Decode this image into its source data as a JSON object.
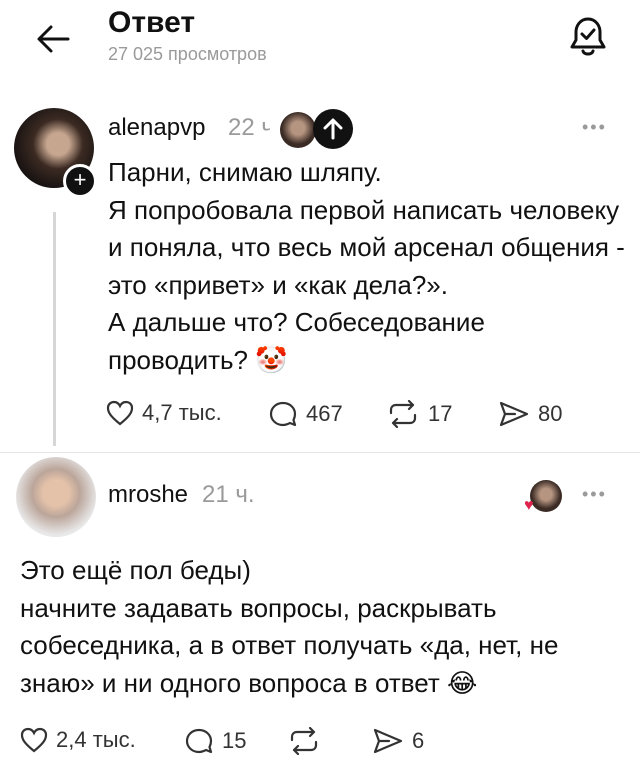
{
  "header": {
    "title": "Ответ",
    "subtitle": "27 025 просмотров",
    "back_icon": "arrow-left-icon",
    "notify_icon": "bell-check-icon"
  },
  "posts": [
    {
      "username": "alenapvp",
      "time": "22 ч.",
      "text": "Парни, снимаю шляпу.\nЯ попробовала первой написать человеку и поняла, что весь мой арсенал общения - это «привет» и «как дела?».\nА дальше что? Собеседование проводить? 🤡",
      "likes": "4,7 тыс.",
      "replies": "467",
      "reposts": "17",
      "shares": "80"
    },
    {
      "username": "mroshe",
      "time": "21 ч.",
      "text": "Это ещё пол беды)\nначните задавать вопросы, раскрывать собеседника, а в ответ получать «да, нет, не знаю» и ни одного вопроса в ответ 😂",
      "likes": "2,4 тыс.",
      "replies": "15",
      "reposts": "",
      "shares": "6"
    }
  ],
  "more_label": "•••",
  "plus_label": "+",
  "colors": {
    "accent": "#111111",
    "muted": "#9a9a9a",
    "heart": "#e0234e"
  }
}
